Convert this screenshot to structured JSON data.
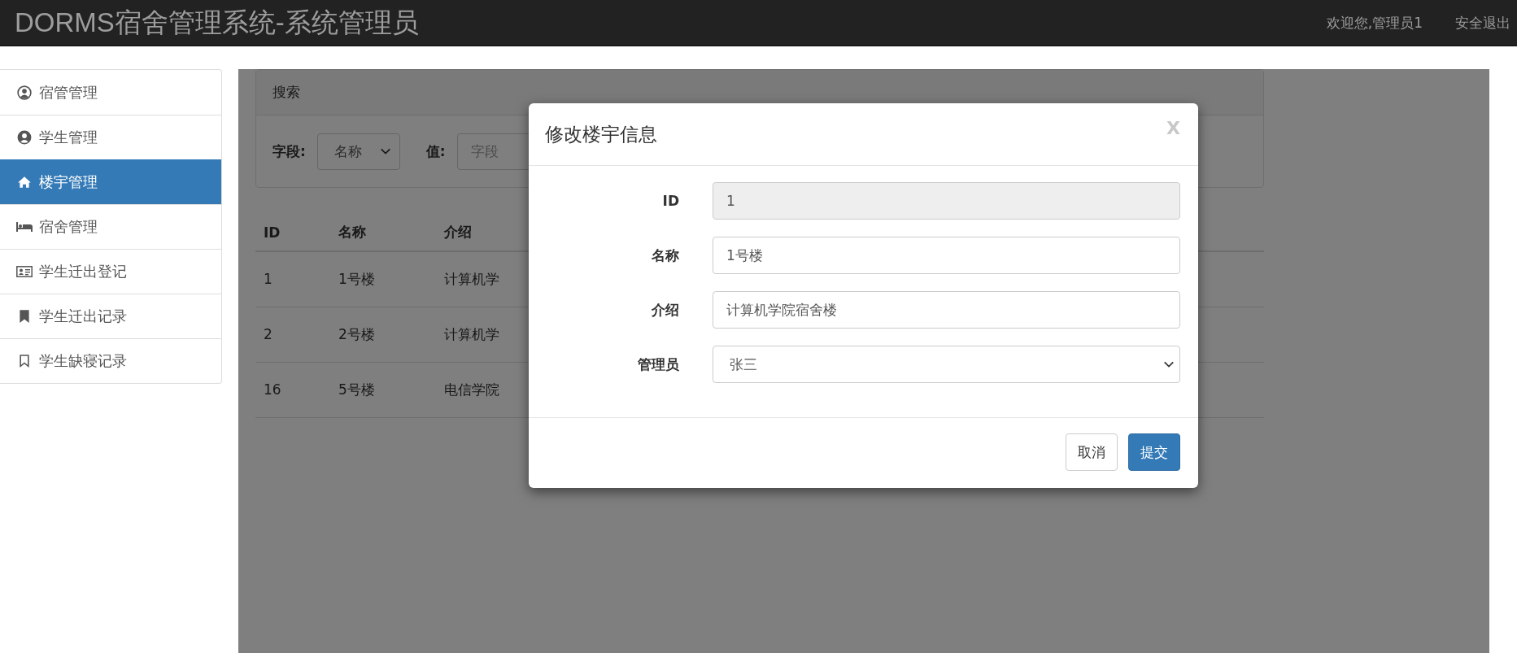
{
  "navbar": {
    "brand": "DORMS宿舍管理系统-系统管理员",
    "welcome": "欢迎您,管理员1",
    "logout": "安全退出"
  },
  "sidebar": {
    "items": [
      {
        "label": "宿管管理",
        "selected": false
      },
      {
        "label": "学生管理",
        "selected": false
      },
      {
        "label": "楼宇管理",
        "selected": true
      },
      {
        "label": "宿舍管理",
        "selected": false
      },
      {
        "label": "学生迁出登记",
        "selected": false
      },
      {
        "label": "学生迁出记录",
        "selected": false
      },
      {
        "label": "学生缺寝记录",
        "selected": false
      }
    ]
  },
  "search": {
    "title": "搜索",
    "field_label": "字段:",
    "field_value": "名称",
    "value_label": "值:",
    "value_placeholder": "字段"
  },
  "table": {
    "columns": [
      "ID",
      "名称",
      "介绍"
    ],
    "rows": [
      [
        "1",
        "1号楼",
        "计算机学"
      ],
      [
        "2",
        "2号楼",
        "计算机学"
      ],
      [
        "16",
        "5号楼",
        "电信学院"
      ]
    ]
  },
  "modal": {
    "title": "修改楼宇信息",
    "close": "X",
    "fields": [
      {
        "label": "ID",
        "value": "1",
        "kind": "text",
        "disabled": true
      },
      {
        "label": "名称",
        "value": "1号楼",
        "kind": "text",
        "disabled": false
      },
      {
        "label": "介绍",
        "value": "计算机学院宿舍楼",
        "kind": "text",
        "disabled": false
      },
      {
        "label": "管理员",
        "value": "张三",
        "kind": "select",
        "disabled": false
      }
    ],
    "buttons": [
      {
        "label": "取消",
        "kind": "default"
      },
      {
        "label": "提交",
        "kind": "primary"
      }
    ]
  }
}
